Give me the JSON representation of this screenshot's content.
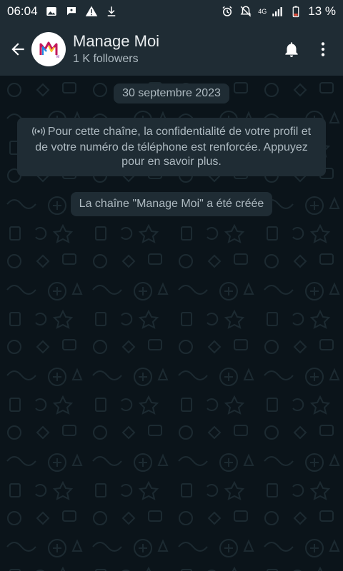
{
  "status_bar": {
    "time": "06:04",
    "network": "4G",
    "battery": "13 %"
  },
  "header": {
    "channel_name": "Manage Moi",
    "followers": "1 K followers",
    "avatar_letter": "M"
  },
  "chat": {
    "date_chip": "30 septembre 2023",
    "privacy_notice": "Pour cette chaîne, la confidentialité de votre profil et de votre numéro de téléphone est renforcée. Appuyez pour en savoir plus.",
    "system_message": "La chaîne \"Manage Moi\" a été créée"
  },
  "colors": {
    "bar": "#1f2c34",
    "background": "#0b141a",
    "bubble": "#1f2c34",
    "secondary_text": "#aebac1",
    "battery_low": "#e04d3b"
  }
}
